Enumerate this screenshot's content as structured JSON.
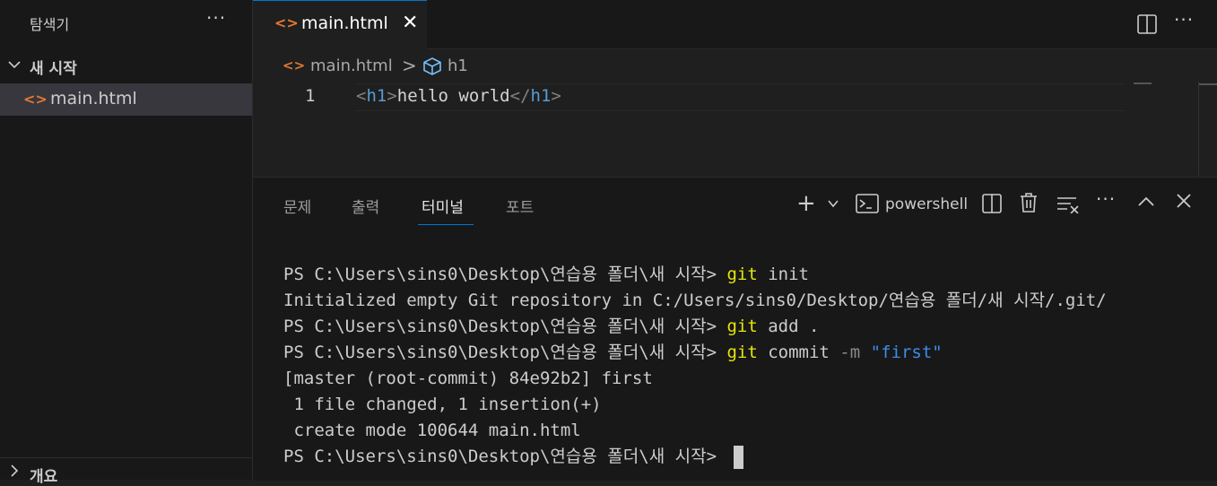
{
  "sidebar": {
    "title": "탐색기",
    "more_icon": "ellipsis-icon",
    "folder_label": "새 시작",
    "file_label": "main.html",
    "outline_label": "개요"
  },
  "tabs": {
    "active_label": "main.html",
    "icon": "html-file-icon"
  },
  "breadcrumb": {
    "file": "main.html",
    "separator": ">",
    "symbol": "h1"
  },
  "editor": {
    "line_number": "1",
    "code": {
      "open_lt": "<",
      "open_tag": "h1",
      "open_gt": ">",
      "text": "hello world",
      "close_lt": "</",
      "close_tag": "h1",
      "close_gt": ">"
    }
  },
  "panel": {
    "tabs": [
      "문제",
      "출력",
      "터미널",
      "포트"
    ],
    "active_tab": "터미널",
    "shell_label": "powershell"
  },
  "terminal": {
    "prompt": "PS C:\\Users\\sins0\\Desktop\\연습용 폴더\\새 시작> ",
    "lines": {
      "cmd1": "git",
      "cmd1_args": " init",
      "out1": "Initialized empty Git repository in C:/Users/sins0/Desktop/연습용 폴더/새 시작/.git/",
      "cmd2": "git",
      "cmd2_args": " add .",
      "cmd3": "git",
      "cmd3_mid": " commit ",
      "cmd3_flag": "-m",
      "cmd3_str": " \"first\"",
      "out2": "[master (root-commit) 84e92b2] first",
      "out3": " 1 file changed, 1 insertion(+)",
      "out4": " create mode 100644 main.html"
    }
  },
  "colors": {
    "accent": "#0078d4",
    "html_icon": "#e37933",
    "command_yellow": "#e5e510",
    "string_blue": "#3b8eea"
  }
}
